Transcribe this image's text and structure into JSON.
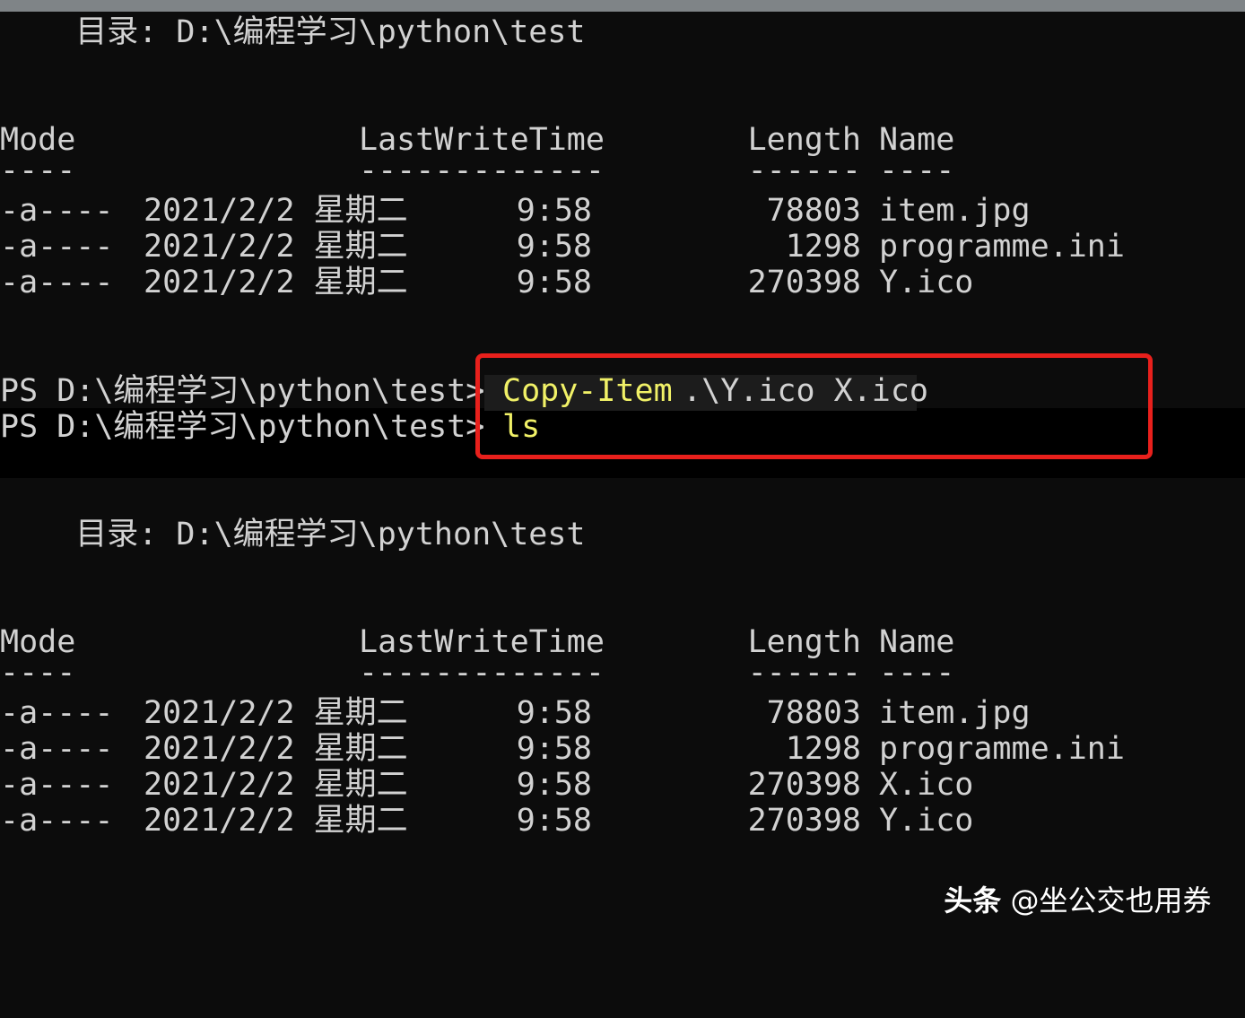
{
  "listing1": {
    "directory": "    目录: D:\\编程学习\\python\\test",
    "headers": {
      "mode": "Mode",
      "lastwritetime": "LastWriteTime",
      "length": "Length",
      "name": "Name"
    },
    "underlines": {
      "mode": "----",
      "lastwritetime": "-------------",
      "length": "------",
      "name": "----"
    },
    "rows": [
      {
        "mode": "-a----",
        "date": "2021/2/2 星期二",
        "time": "9:58",
        "length": "78803",
        "name": "item.jpg"
      },
      {
        "mode": "-a----",
        "date": "2021/2/2 星期二",
        "time": "9:58",
        "length": "1298",
        "name": "programme.ini"
      },
      {
        "mode": "-a----",
        "date": "2021/2/2 星期二",
        "time": "9:58",
        "length": "270398",
        "name": "Y.ico"
      }
    ]
  },
  "commands": [
    {
      "prompt": "PS D:\\编程学习\\python\\test>",
      "cmd": "Copy-Item",
      "args": " .\\Y.ico X.ico"
    },
    {
      "prompt": "PS D:\\编程学习\\python\\test>",
      "cmd": "ls",
      "args": ""
    }
  ],
  "listing2": {
    "directory": "    目录: D:\\编程学习\\python\\test",
    "headers": {
      "mode": "Mode",
      "lastwritetime": "LastWriteTime",
      "length": "Length",
      "name": "Name"
    },
    "underlines": {
      "mode": "----",
      "lastwritetime": "-------------",
      "length": "------",
      "name": "----"
    },
    "rows": [
      {
        "mode": "-a----",
        "date": "2021/2/2 星期二",
        "time": "9:58",
        "length": "78803",
        "name": "item.jpg"
      },
      {
        "mode": "-a----",
        "date": "2021/2/2 星期二",
        "time": "9:58",
        "length": "1298",
        "name": "programme.ini"
      },
      {
        "mode": "-a----",
        "date": "2021/2/2 星期二",
        "time": "9:58",
        "length": "270398",
        "name": "X.ico"
      },
      {
        "mode": "-a----",
        "date": "2021/2/2 星期二",
        "time": "9:58",
        "length": "270398",
        "name": "Y.ico"
      }
    ]
  },
  "watermark": {
    "brand": "头条",
    "handle": " @坐公交也用券"
  },
  "colors": {
    "background": "#0c0c0c",
    "text": "#d2d2d2",
    "command": "#f1f167",
    "annotation_box": "#e8201c"
  }
}
